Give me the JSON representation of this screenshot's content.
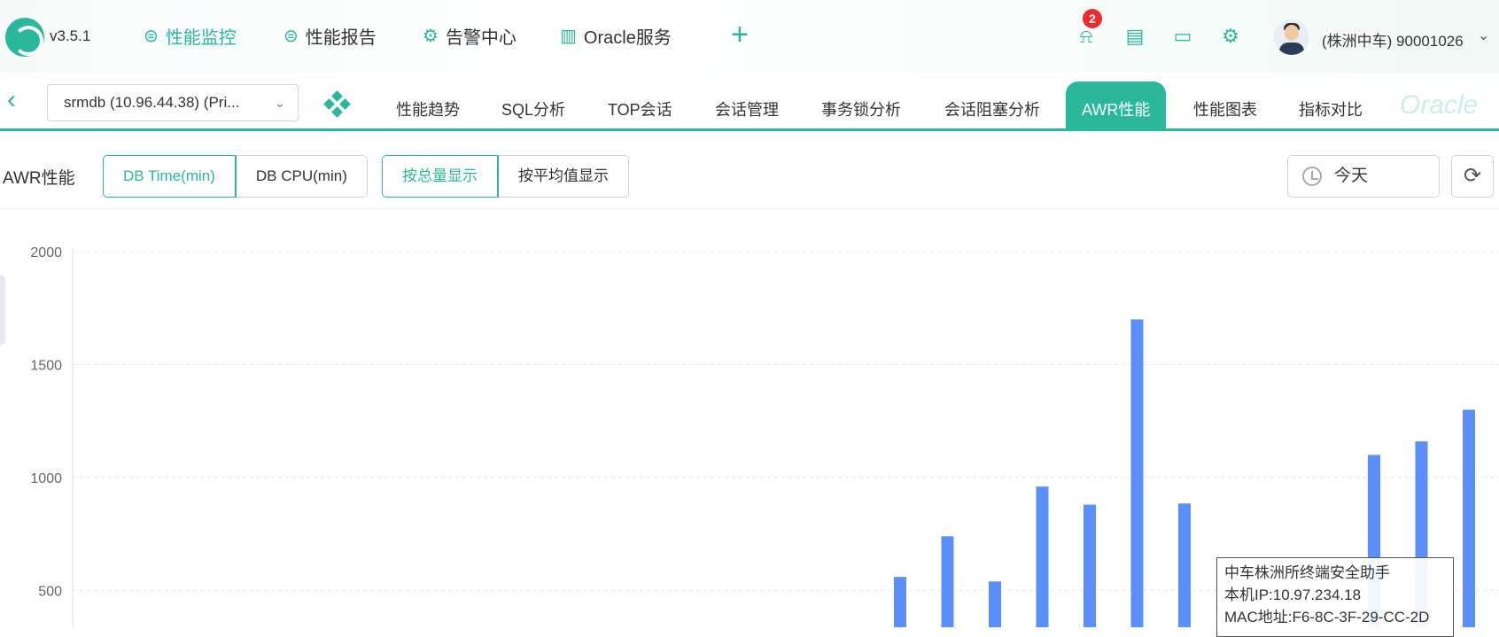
{
  "app": {
    "version": "v3.5.1",
    "nav": [
      {
        "label": "性能监控",
        "icon": "monitor-icon",
        "active": true
      },
      {
        "label": "性能报告",
        "icon": "report-icon",
        "active": false
      },
      {
        "label": "告警中心",
        "icon": "alarm-gear-icon",
        "active": false
      },
      {
        "label": "Oracle服务",
        "icon": "bars-icon",
        "active": false
      }
    ],
    "alert_count": "2",
    "user": "(株洲中车) 90001026"
  },
  "subnav": {
    "db_select": "srmdb (10.96.44.38) (Pri...",
    "tabs": [
      "性能趋势",
      "SQL分析",
      "TOP会话",
      "会话管理",
      "事务锁分析",
      "会话阻塞分析",
      "AWR性能",
      "性能图表",
      "指标对比"
    ],
    "active_tab": 6
  },
  "toolbar": {
    "title": "AWR性能",
    "metric_buttons": [
      "DB Time(min)",
      "DB CPU(min)"
    ],
    "display_buttons": [
      "按总量显示",
      "按平均值显示"
    ],
    "date": "今天"
  },
  "chart_data": {
    "type": "bar",
    "ylim": [
      0,
      2200
    ],
    "yticks": [
      500,
      1000,
      1500,
      2000
    ],
    "grid": true,
    "color": "#5b8ff9",
    "values": [
      {
        "slot": 19,
        "value": 560
      },
      {
        "slot": 20,
        "value": 740
      },
      {
        "slot": 21,
        "value": 540
      },
      {
        "slot": 22,
        "value": 960
      },
      {
        "slot": 23,
        "value": 880
      },
      {
        "slot": 24,
        "value": 1700
      },
      {
        "slot": 25,
        "value": 885
      },
      {
        "slot": 29,
        "value": 1100
      },
      {
        "slot": 30,
        "value": 1160
      },
      {
        "slot": 31,
        "value": 1300
      }
    ]
  },
  "tooltip": {
    "line1": "中车株洲所终端安全助手",
    "line2": "本机IP:10.97.234.18",
    "line3": "MAC地址:F6-8C-3F-29-CC-2D"
  }
}
